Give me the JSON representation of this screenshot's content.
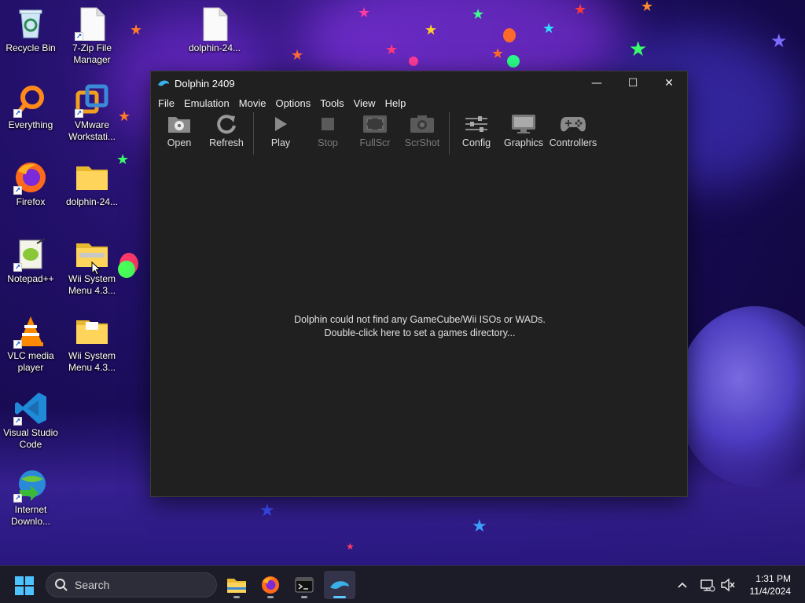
{
  "desktop": {
    "icons": [
      {
        "label": "Recycle Bin",
        "icon": "recycle-bin-icon"
      },
      {
        "label": "7-Zip File Manager",
        "icon": "file-icon"
      },
      {
        "label": "dolphin-24...",
        "icon": "file-icon"
      },
      {
        "label": "Everything",
        "icon": "search-icon"
      },
      {
        "label": "VMware Workstati...",
        "icon": "vmware-icon"
      },
      {
        "label": "Firefox",
        "icon": "firefox-icon"
      },
      {
        "label": "dolphin-24...",
        "icon": "folder-icon"
      },
      {
        "label": "Notepad++",
        "icon": "notepad-plus-plus-icon"
      },
      {
        "label": "Wii System Menu 4.3...",
        "icon": "zip-folder-icon"
      },
      {
        "label": "VLC media player",
        "icon": "vlc-icon"
      },
      {
        "label": "Wii System Menu 4.3...",
        "icon": "folder-icon"
      },
      {
        "label": "Visual Studio Code",
        "icon": "vscode-icon"
      },
      {
        "label": "Internet Downlo...",
        "icon": "internet-download-manager-icon"
      }
    ]
  },
  "window": {
    "title": "Dolphin 2409",
    "controls": {
      "minimize": "—",
      "maximize": "☐",
      "close": "✕"
    },
    "menu": [
      "File",
      "Emulation",
      "Movie",
      "Options",
      "Tools",
      "View",
      "Help"
    ],
    "toolbar": {
      "open": "Open",
      "refresh": "Refresh",
      "play": "Play",
      "stop": "Stop",
      "fullscr": "FullScr",
      "scrshot": "ScrShot",
      "config": "Config",
      "graphics": "Graphics",
      "controllers": "Controllers"
    },
    "empty_message": {
      "line1": "Dolphin could not find any GameCube/Wii ISOs or WADs.",
      "line2": "Double-click here to set a games directory..."
    }
  },
  "taskbar": {
    "search_placeholder": "Search",
    "apps": [
      "file-explorer-icon",
      "firefox-icon",
      "terminal-icon",
      "dolphin-icon"
    ],
    "clock": {
      "time": "1:31 PM",
      "date": "11/4/2024"
    }
  },
  "colors": {
    "window_bg": "#202020",
    "taskbar_bg": "#1c1c28",
    "accent": "#5cc8ff"
  }
}
